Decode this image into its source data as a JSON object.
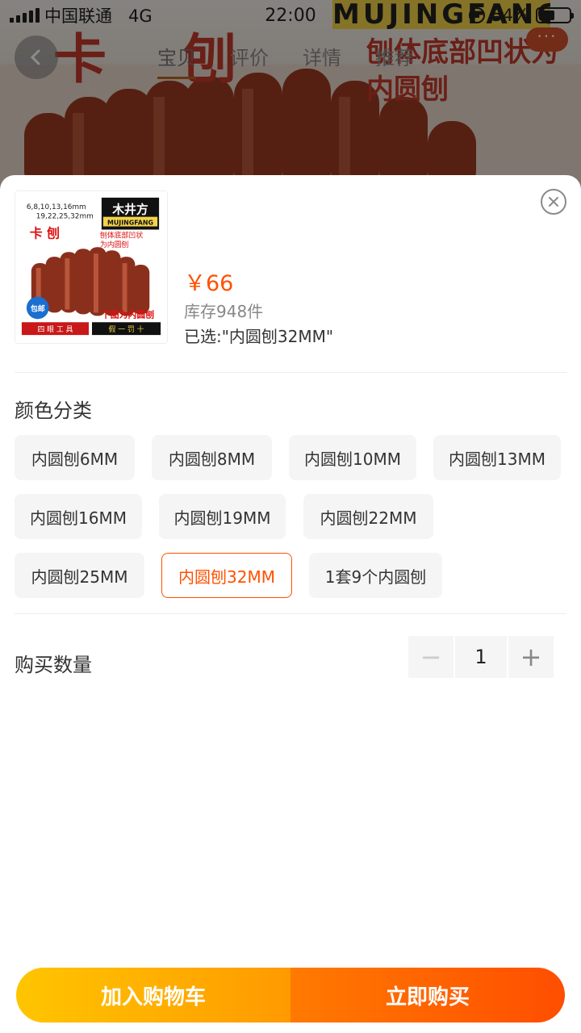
{
  "status_bar": {
    "carrier": "中国联通",
    "network": "4G",
    "time": "22:00",
    "battery": "54%",
    "battery_level": 0.54
  },
  "background_page": {
    "tabs": [
      "宝贝",
      "评价",
      "详情",
      "推荐"
    ],
    "active_tab": "宝贝",
    "overlay_title": "卡 刨",
    "overlay_brand": "MUJINGFANG",
    "overlay_caption": "刨体底部凹状为内圆刨",
    "more_button": "···"
  },
  "product_thumb": {
    "sizes_line1": "6,8,10,13,16mm",
    "sizes_line2": "19,22,25,32mm",
    "brand_cn": "木井方",
    "brand_en": "MUJINGFANG",
    "title": "卡 刨",
    "caption1": "刨体底部凹状",
    "caption2": "为内圆刨",
    "badge": "包邮",
    "bottom_note": "下图为内圆刨",
    "footer_left": "四 眼 工 具",
    "footer_right": "假 一 罚 十"
  },
  "sheet": {
    "price": "￥66",
    "stock": "库存948件",
    "selected": "已选:\"内圆刨32MM\"",
    "color_section_title": "颜色分类",
    "options": [
      "内圆刨6MM",
      "内圆刨8MM",
      "内圆刨10MM",
      "内圆刨13MM",
      "内圆刨16MM",
      "内圆刨19MM",
      "内圆刨22MM",
      "内圆刨25MM",
      "内圆刨32MM",
      "1套9个内圆刨"
    ],
    "selected_option_index": 8,
    "quantity_label": "购买数量",
    "quantity_minus": "−",
    "quantity_value": "1",
    "quantity_plus": "+",
    "add_to_cart": "加入购物车",
    "buy_now": "立即购买"
  },
  "colors": {
    "accent": "#ff5000",
    "cart_gradient": [
      "#ffc500",
      "#ff9a00"
    ],
    "buy_gradient": [
      "#ff7a00",
      "#ff4e00"
    ]
  }
}
